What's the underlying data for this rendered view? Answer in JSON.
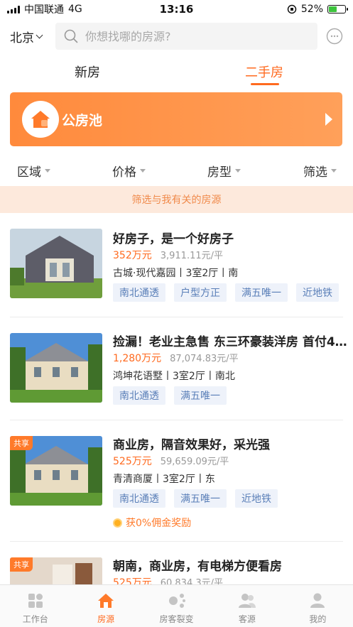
{
  "status_bar": {
    "carrier": "中国联通",
    "network": "4G",
    "time": "13:16",
    "battery": "52%",
    "battery_level": 0.52
  },
  "header": {
    "city": "北京",
    "search_placeholder": "你想找哪的房源?"
  },
  "tabs": [
    {
      "label": "新房",
      "active": false
    },
    {
      "label": "二手房",
      "active": true
    }
  ],
  "banner": {
    "title": "公房池"
  },
  "filters": [
    "区域",
    "价格",
    "房型",
    "筛选"
  ],
  "notice": "筛选与我有关的房源",
  "listings": [
    {
      "title": "好房子，是一个好房子",
      "price": "352万元",
      "unit_price": "3,911.11元/平",
      "info": "古城·现代嘉园丨3室2厅丨南",
      "tags": [
        "南北通透",
        "户型方正",
        "满五唯一",
        "近地铁"
      ],
      "shared": false,
      "commission": ""
    },
    {
      "title": "捡漏！老业主急售 东三环豪装洋房 首付4...",
      "price": "1,280万元",
      "unit_price": "87,074.83元/平",
      "info": "鸿坤花语墅丨3室2厅丨南北",
      "tags": [
        "南北通透",
        "满五唯一"
      ],
      "shared": false,
      "commission": ""
    },
    {
      "title": "商业房，隔音效果好，采光强",
      "price": "525万元",
      "unit_price": "59,659.09元/平",
      "info": "青清商厦丨3室2厅丨东",
      "tags": [
        "南北通透",
        "满五唯一",
        "近地铁"
      ],
      "shared": true,
      "shared_label": "共享",
      "commission": "获0%佣金奖励"
    },
    {
      "title": "朝南，商业房，有电梯方便看房",
      "price": "525万元",
      "unit_price": "60,834.3元/平",
      "info": "",
      "tags": [],
      "shared": true,
      "shared_label": "共享",
      "commission": ""
    }
  ],
  "bottom_nav": [
    {
      "label": "工作台",
      "icon": "grid-icon",
      "active": false
    },
    {
      "label": "房源",
      "icon": "house-icon",
      "active": true
    },
    {
      "label": "房客裂变",
      "icon": "share-icon",
      "active": false
    },
    {
      "label": "客源",
      "icon": "people-icon",
      "active": false
    },
    {
      "label": "我的",
      "icon": "person-icon",
      "active": false
    }
  ],
  "colors": {
    "accent": "#ff6a1f",
    "tag_bg": "#eef2fa",
    "tag_text": "#5a7fb8",
    "notice_bg": "#fde9dc"
  }
}
